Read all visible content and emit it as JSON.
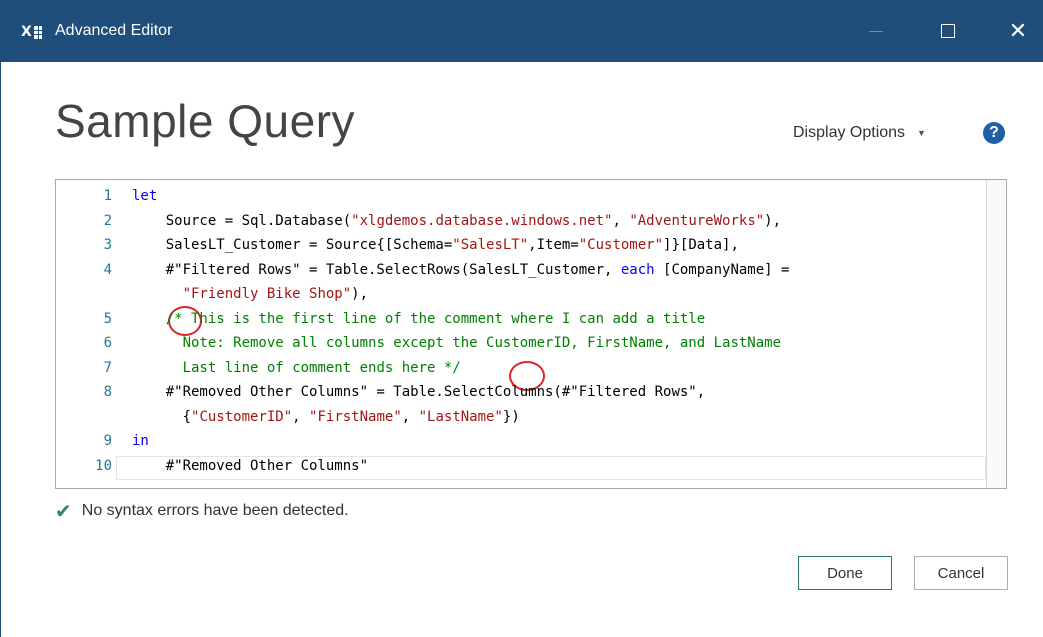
{
  "window": {
    "title": "Advanced Editor",
    "app_icon": "excel-icon",
    "controls": [
      "minimize-icon",
      "maximize-icon",
      "close-icon"
    ],
    "close_glyph": "✕"
  },
  "header": {
    "query_name": "Sample Query",
    "display_options_label": "Display Options",
    "display_options_caret": "▼",
    "help_glyph": "?"
  },
  "editor": {
    "lines": [
      {
        "num": "1",
        "tokens": [
          {
            "t": "let",
            "c": "kw"
          }
        ]
      },
      {
        "num": "2",
        "tokens": [
          {
            "t": "    Source = Sql.Database(",
            "c": ""
          },
          {
            "t": "\"xlgdemos.database.windows.net\"",
            "c": "str"
          },
          {
            "t": ", ",
            "c": ""
          },
          {
            "t": "\"AdventureWorks\"",
            "c": "str"
          },
          {
            "t": "),",
            "c": ""
          }
        ]
      },
      {
        "num": "3",
        "tokens": [
          {
            "t": "    SalesLT_Customer = Source{[Schema=",
            "c": ""
          },
          {
            "t": "\"SalesLT\"",
            "c": "str"
          },
          {
            "t": ",Item=",
            "c": ""
          },
          {
            "t": "\"Customer\"",
            "c": "str"
          },
          {
            "t": "]}[Data],",
            "c": ""
          }
        ]
      },
      {
        "num": "4",
        "tokens": [
          {
            "t": "    #\"Filtered Rows\" = Table.SelectRows(SalesLT_Customer, ",
            "c": ""
          },
          {
            "t": "each",
            "c": "kw"
          },
          {
            "t": " [CompanyName] =",
            "c": ""
          }
        ]
      },
      {
        "num": "",
        "tokens": [
          {
            "t": "      ",
            "c": ""
          },
          {
            "t": "\"Friendly Bike Shop\"",
            "c": "str"
          },
          {
            "t": "),",
            "c": ""
          }
        ]
      },
      {
        "num": "5",
        "tokens": [
          {
            "t": "    ",
            "c": ""
          },
          {
            "t": "/* This is the first line of the comment where I can add a title",
            "c": "cm"
          }
        ]
      },
      {
        "num": "6",
        "tokens": [
          {
            "t": "      ",
            "c": ""
          },
          {
            "t": "Note: Remove all columns except the CustomerID, FirstName, and LastName",
            "c": "cm"
          }
        ]
      },
      {
        "num": "7",
        "tokens": [
          {
            "t": "      ",
            "c": ""
          },
          {
            "t": "Last line of comment ends here */",
            "c": "cm"
          }
        ]
      },
      {
        "num": "8",
        "tokens": [
          {
            "t": "    #\"Removed Other Columns\" = Table.SelectColumns(#\"Filtered Rows\",",
            "c": ""
          }
        ]
      },
      {
        "num": "",
        "tokens": [
          {
            "t": "      {",
            "c": ""
          },
          {
            "t": "\"CustomerID\"",
            "c": "str"
          },
          {
            "t": ", ",
            "c": ""
          },
          {
            "t": "\"FirstName\"",
            "c": "str"
          },
          {
            "t": ", ",
            "c": ""
          },
          {
            "t": "\"LastName\"",
            "c": "str"
          },
          {
            "t": "})",
            "c": ""
          }
        ]
      },
      {
        "num": "9",
        "tokens": [
          {
            "t": "in",
            "c": "kw"
          }
        ]
      },
      {
        "num": "10",
        "tokens": [
          {
            "t": "    #\"Removed Other Columns\"",
            "c": ""
          }
        ]
      }
    ]
  },
  "status": {
    "icon": "check-icon",
    "glyph": "✔",
    "text": "No syntax errors have been detected."
  },
  "buttons": {
    "done": "Done",
    "cancel": "Cancel"
  },
  "colors": {
    "titlebar": "#1e4e79",
    "keyword": "#0000ff",
    "string": "#a31515",
    "comment": "#008000",
    "annotation_circle": "#e02424"
  }
}
